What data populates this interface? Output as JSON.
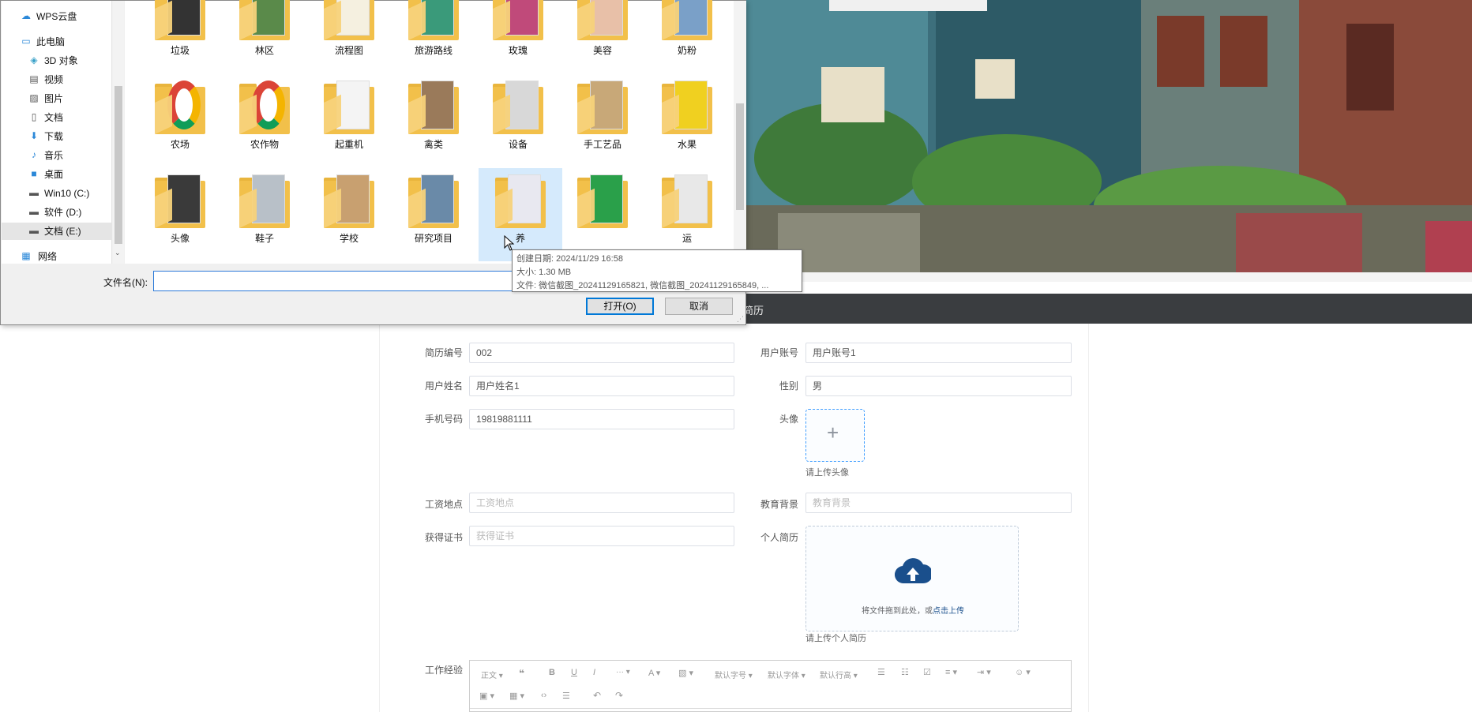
{
  "dialog": {
    "nav": [
      {
        "label": "WPS云盘",
        "icon": "cloud-icon"
      },
      {
        "label": "此电脑",
        "icon": "computer-icon"
      },
      {
        "label": "3D 对象",
        "icon": "cube-icon"
      },
      {
        "label": "视频",
        "icon": "video-icon"
      },
      {
        "label": "图片",
        "icon": "picture-icon"
      },
      {
        "label": "文档",
        "icon": "document-icon"
      },
      {
        "label": "下载",
        "icon": "download-icon"
      },
      {
        "label": "音乐",
        "icon": "music-icon"
      },
      {
        "label": "桌面",
        "icon": "desktop-icon"
      },
      {
        "label": "Win10 (C:)",
        "icon": "drive-icon"
      },
      {
        "label": "软件 (D:)",
        "icon": "drive-icon"
      },
      {
        "label": "文档 (E:)",
        "icon": "drive-icon"
      },
      {
        "label": "网络",
        "icon": "network-icon"
      }
    ],
    "folders_row1": [
      "垃圾",
      "林区",
      "流程图",
      "旅游路线",
      "玫瑰",
      "美容",
      "奶粉"
    ],
    "folders_row2": [
      "农场",
      "农作物",
      "起重机",
      "禽类",
      "设备",
      "手工艺品",
      "水果"
    ],
    "folders_row3": [
      "头像",
      "鞋子",
      "学校",
      "研究项目",
      "养",
      "",
      "运"
    ],
    "filename_label": "文件名(N):",
    "filename_value": "",
    "open_label": "打开(O)",
    "cancel_label": "取消",
    "tooltip": {
      "created": "创建日期: 2024/11/29 16:58",
      "size": "大小: 1.30 MB",
      "files": "文件: 微信截图_20241129165821, 微信截图_20241129165849, ..."
    }
  },
  "navbar": {
    "title": "的简历"
  },
  "form": {
    "resume_no_label": "简历编号",
    "resume_no_value": "002",
    "account_label": "用户账号",
    "account_value": "用户账号1",
    "name_label": "用户姓名",
    "name_value": "用户姓名1",
    "gender_label": "性别",
    "gender_value": "男",
    "phone_label": "手机号码",
    "phone_value": "19819881111",
    "avatar_label": "头像",
    "avatar_hint": "请上传头像",
    "salary_label": "工资地点",
    "salary_placeholder": "工资地点",
    "edu_label": "教育背景",
    "edu_placeholder": "教育背景",
    "cert_label": "获得证书",
    "cert_placeholder": "获得证书",
    "resume_label": "个人简历",
    "resume_drop_text": "将文件拖到此处，或",
    "resume_drop_link": "点击上传",
    "resume_hint": "请上传个人简历",
    "exp_label": "工作经验"
  },
  "editor": {
    "paragraph": "正文",
    "font_size": "默认字号",
    "font_family": "默认字体",
    "line_height": "默认行高"
  },
  "colors": {
    "accent": "#0078d7",
    "navbar": "#3a3d40",
    "upload": "#1a4f8c"
  }
}
